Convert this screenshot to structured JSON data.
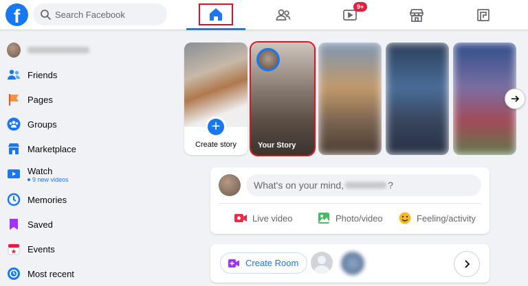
{
  "topbar": {
    "logo_letter": "f",
    "search_placeholder": "Search Facebook",
    "tabs": [
      {
        "name": "home",
        "icon": "home-icon",
        "active": true
      },
      {
        "name": "friends",
        "icon": "friends-icon"
      },
      {
        "name": "watch",
        "icon": "watch-icon",
        "badge": "9+"
      },
      {
        "name": "marketplace",
        "icon": "marketplace-icon"
      },
      {
        "name": "gaming",
        "icon": "gaming-icon"
      }
    ],
    "brand_color": "#1877f2",
    "highlight_color": "#e4101f"
  },
  "sidebar": {
    "items": [
      {
        "label": "",
        "icon": "profile-avatar"
      },
      {
        "label": "Friends",
        "icon": "friends-icon"
      },
      {
        "label": "Pages",
        "icon": "pages-flag-icon"
      },
      {
        "label": "Groups",
        "icon": "groups-icon"
      },
      {
        "label": "Marketplace",
        "icon": "marketplace-icon"
      },
      {
        "label": "Watch",
        "sub": "9 new videos",
        "icon": "watch-icon"
      },
      {
        "label": "Memories",
        "icon": "memories-clock-icon"
      },
      {
        "label": "Saved",
        "icon": "saved-bookmark-icon"
      },
      {
        "label": "Events",
        "icon": "events-calendar-icon"
      },
      {
        "label": "Most recent",
        "icon": "most-recent-icon"
      }
    ]
  },
  "stories": {
    "create_label": "Create story",
    "your_story_label": "Your Story"
  },
  "composer": {
    "prompt_prefix": "What's on your mind,",
    "prompt_suffix": "?",
    "actions": [
      {
        "label": "Live video",
        "icon": "live-video-icon",
        "color": "#f02849"
      },
      {
        "label": "Photo/video",
        "icon": "photo-icon",
        "color": "#45bd62"
      },
      {
        "label": "Feeling/activity",
        "icon": "feeling-icon",
        "color": "#f7b928"
      }
    ]
  },
  "rooms": {
    "create_room_label": "Create Room"
  }
}
